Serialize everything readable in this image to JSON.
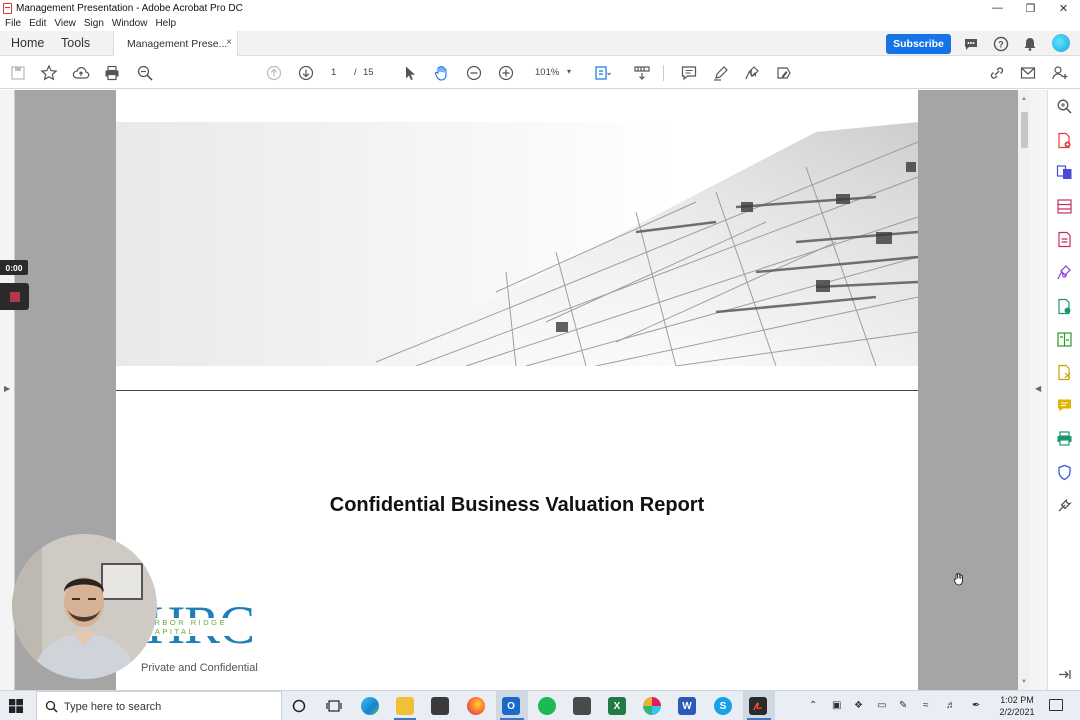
{
  "window": {
    "title": "Management Presentation - Adobe Acrobat Pro DC"
  },
  "menu": [
    "File",
    "Edit",
    "View",
    "Sign",
    "Window",
    "Help"
  ],
  "tabs": {
    "home": "Home",
    "tools": "Tools",
    "document": "Management Prese...",
    "close": "×"
  },
  "subscribe_label": "Subscribe",
  "toolbar": {
    "page_current": "1",
    "page_separator": "/",
    "page_total": "15",
    "zoom": "101%",
    "zoom_caret": "▾"
  },
  "document": {
    "title": "Confidential Business Valuation Report",
    "logo_letters": "HRC",
    "logo_subtitle": "ARBOR RIDGE CAPITAL",
    "footer_label": "Private and Confidential"
  },
  "recording": {
    "elapsed": "0:00"
  },
  "taskbar": {
    "search_placeholder": "Type here to search",
    "time": "1:02 PM",
    "date": "2/2/2021",
    "apps": [
      "Cortana",
      "Task View",
      "Edge",
      "File Explorer",
      "Store",
      "Firefox",
      "Outlook",
      "Spotify",
      "Calculator",
      "Excel",
      "Slack",
      "Word",
      "Skype",
      "Acrobat"
    ]
  },
  "colors": {
    "accent": "#1473e6",
    "logo_blue": "#1f7fb8",
    "logo_green": "#6aa83a",
    "record": "#b3384a"
  }
}
